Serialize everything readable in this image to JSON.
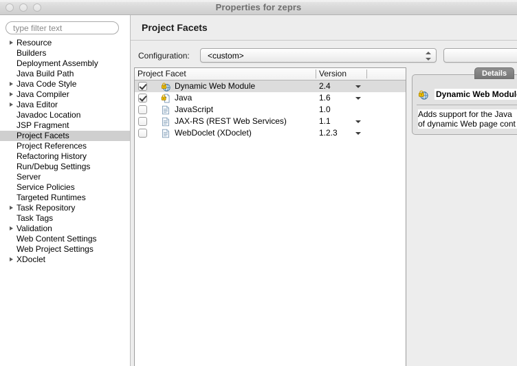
{
  "window": {
    "title": "Properties for zeprs",
    "traffic_lights": [
      "close",
      "minimize",
      "maximize"
    ]
  },
  "sidebar": {
    "filter": {
      "value": "",
      "placeholder": "type filter text"
    },
    "items": [
      {
        "label": "Resource",
        "expandable": true,
        "selected": false
      },
      {
        "label": "Builders",
        "expandable": false,
        "selected": false
      },
      {
        "label": "Deployment Assembly",
        "expandable": false,
        "selected": false
      },
      {
        "label": "Java Build Path",
        "expandable": false,
        "selected": false
      },
      {
        "label": "Java Code Style",
        "expandable": true,
        "selected": false
      },
      {
        "label": "Java Compiler",
        "expandable": true,
        "selected": false
      },
      {
        "label": "Java Editor",
        "expandable": true,
        "selected": false
      },
      {
        "label": "Javadoc Location",
        "expandable": false,
        "selected": false
      },
      {
        "label": "JSP Fragment",
        "expandable": false,
        "selected": false
      },
      {
        "label": "Project Facets",
        "expandable": false,
        "selected": true
      },
      {
        "label": "Project References",
        "expandable": false,
        "selected": false
      },
      {
        "label": "Refactoring History",
        "expandable": false,
        "selected": false
      },
      {
        "label": "Run/Debug Settings",
        "expandable": false,
        "selected": false
      },
      {
        "label": "Server",
        "expandable": false,
        "selected": false
      },
      {
        "label": "Service Policies",
        "expandable": false,
        "selected": false
      },
      {
        "label": "Targeted Runtimes",
        "expandable": false,
        "selected": false
      },
      {
        "label": "Task Repository",
        "expandable": true,
        "selected": false
      },
      {
        "label": "Task Tags",
        "expandable": false,
        "selected": false
      },
      {
        "label": "Validation",
        "expandable": true,
        "selected": false
      },
      {
        "label": "Web Content Settings",
        "expandable": false,
        "selected": false
      },
      {
        "label": "Web Project Settings",
        "expandable": false,
        "selected": false
      },
      {
        "label": "XDoclet",
        "expandable": true,
        "selected": false
      }
    ]
  },
  "main": {
    "page_title": "Project Facets",
    "configuration": {
      "label": "Configuration:",
      "value": "<custom>"
    },
    "table": {
      "columns": [
        "Project Facet",
        "Version"
      ],
      "rows": [
        {
          "checked": true,
          "icon": "dynamic-web-module-icon",
          "name": "Dynamic Web Module",
          "version": "2.4",
          "has_version_dropdown": true,
          "selected": true
        },
        {
          "checked": true,
          "icon": "java-facet-icon",
          "name": "Java",
          "version": "1.6",
          "has_version_dropdown": true,
          "selected": false
        },
        {
          "checked": false,
          "icon": "document-icon",
          "name": "JavaScript",
          "version": "1.0",
          "has_version_dropdown": false,
          "selected": false
        },
        {
          "checked": false,
          "icon": "document-icon",
          "name": "JAX-RS (REST Web Services)",
          "version": "1.1",
          "has_version_dropdown": true,
          "selected": false
        },
        {
          "checked": false,
          "icon": "document-icon",
          "name": "WebDoclet (XDoclet)",
          "version": "1.2.3",
          "has_version_dropdown": true,
          "selected": false
        }
      ]
    },
    "details": {
      "tab_label": "Details",
      "title": "Dynamic Web Module",
      "description_line1": "Adds support for the Java",
      "description_line2": "of dynamic Web page cont"
    }
  },
  "colors": {
    "window_chrome": "#d9d9d9",
    "content_background": "#ededed",
    "selection": "#cfcfcf",
    "row_selection": "#dcdcdc",
    "details_tab": "#767676",
    "border": "#9c9c9c"
  }
}
